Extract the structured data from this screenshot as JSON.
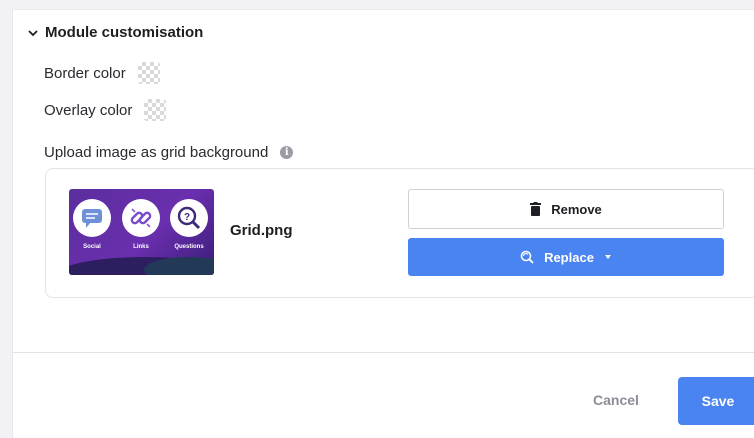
{
  "section": {
    "title": "Module customisation"
  },
  "fields": {
    "border_color_label": "Border color",
    "overlay_color_label": "Overlay color",
    "upload_label": "Upload image as grid background"
  },
  "upload": {
    "filename": "Grid.png",
    "thumbnail_labels": [
      "Social",
      "Links",
      "Questions"
    ],
    "remove_label": "Remove",
    "replace_label": "Replace"
  },
  "footer": {
    "cancel_label": "Cancel",
    "save_label": "Save"
  },
  "colors": {
    "accent": "#4a84f0",
    "thumbnail_bg": "#5b2e9e"
  }
}
